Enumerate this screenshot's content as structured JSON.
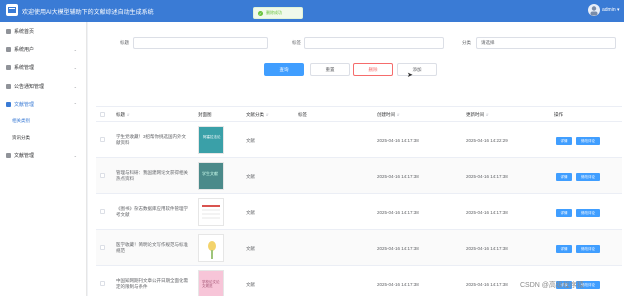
{
  "header": {
    "title": "欢迎使用AI大模型辅助下的文献综述自动生成系统",
    "user": "admin ▾",
    "toast": "删除成功"
  },
  "sidebar": {
    "items": [
      {
        "label": "系统首页",
        "expanded": false
      },
      {
        "label": "系统用户",
        "expanded": false
      },
      {
        "label": "系统管理",
        "expanded": false
      },
      {
        "label": "公告通知管理",
        "expanded": false
      },
      {
        "label": "文献管理",
        "expanded": true
      },
      {
        "label": "文献管理",
        "expanded": false
      }
    ],
    "subitems": [
      "相关类别",
      "资讯分类"
    ]
  },
  "filters": {
    "label1": "标题",
    "label2": "标签",
    "label3": "分类",
    "select_value": "请选择"
  },
  "buttons": {
    "search": "查询",
    "reset": "重置",
    "delete": "删除",
    "add": "添加"
  },
  "table": {
    "headers": [
      "标题",
      "封面图",
      "文献分类",
      "标签",
      "创建时间",
      "更新时间",
      "操作"
    ],
    "rows": [
      {
        "title": "学生党收藏！3招帮你挑选国内外文献资料",
        "category": "文献",
        "tag": "",
        "created": "2025-04-16 14:17:38",
        "updated": "2025-04-16 14:22:29"
      },
      {
        "title": "管理与科研：我国建网论文获得相关热点资料",
        "category": "文献",
        "tag": "",
        "created": "2025-04-16 14:17:38",
        "updated": "2025-04-16 14:17:38"
      },
      {
        "title": "《图书》杂志数据库应用软件管理学考文献",
        "category": "文献",
        "tag": "",
        "created": "2025-04-16 14:17:38",
        "updated": "2025-04-16 14:17:38"
      },
      {
        "title": "医学收藏！简明论文写作规范与标准规范",
        "category": "文献",
        "tag": "",
        "created": "2025-04-16 14:17:38",
        "updated": "2025-04-16 14:17:38"
      },
      {
        "title": "中国知网期刊文章公开日期全面化需定的限制与条件",
        "category": "文献",
        "tag": "",
        "created": "2025-04-16 14:17:38",
        "updated": "2025-04-16 14:17:38"
      }
    ],
    "detail_label": "详情",
    "edit_label": "修改评论"
  },
  "covers": {
    "colors": [
      "#3aa0a8",
      "#4b8a8a",
      "#ffffff",
      "#ffffff",
      "#f7c5d8"
    ],
    "cover1_text": "阿塞拉法论",
    "cover2_text": "学生文献",
    "cover5_text": "学校论文论文规范"
  },
  "watermark": "CSDN @高级程序猿"
}
